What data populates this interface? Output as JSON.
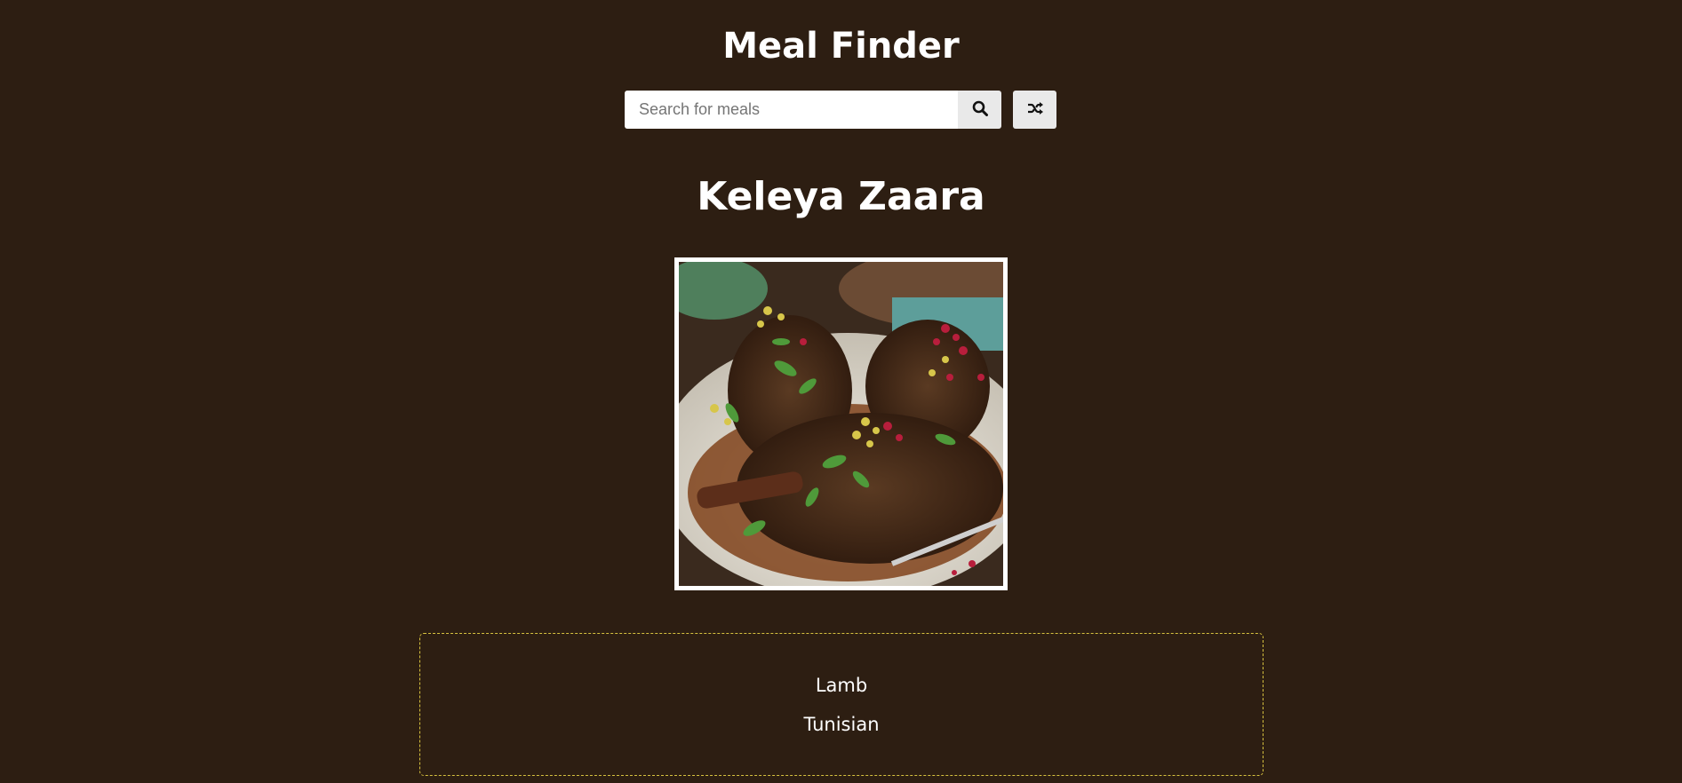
{
  "app": {
    "title": "Meal Finder"
  },
  "search": {
    "placeholder": "Search for meals",
    "value": "",
    "search_icon": "search-icon",
    "random_icon": "shuffle-icon"
  },
  "meal": {
    "name": "Keleya Zaara",
    "category": "Lamb",
    "area": "Tunisian"
  },
  "colors": {
    "background": "#2d1e12",
    "text": "#ffffff",
    "button": "#e9e9e9",
    "info_border": "#d6c13f"
  }
}
